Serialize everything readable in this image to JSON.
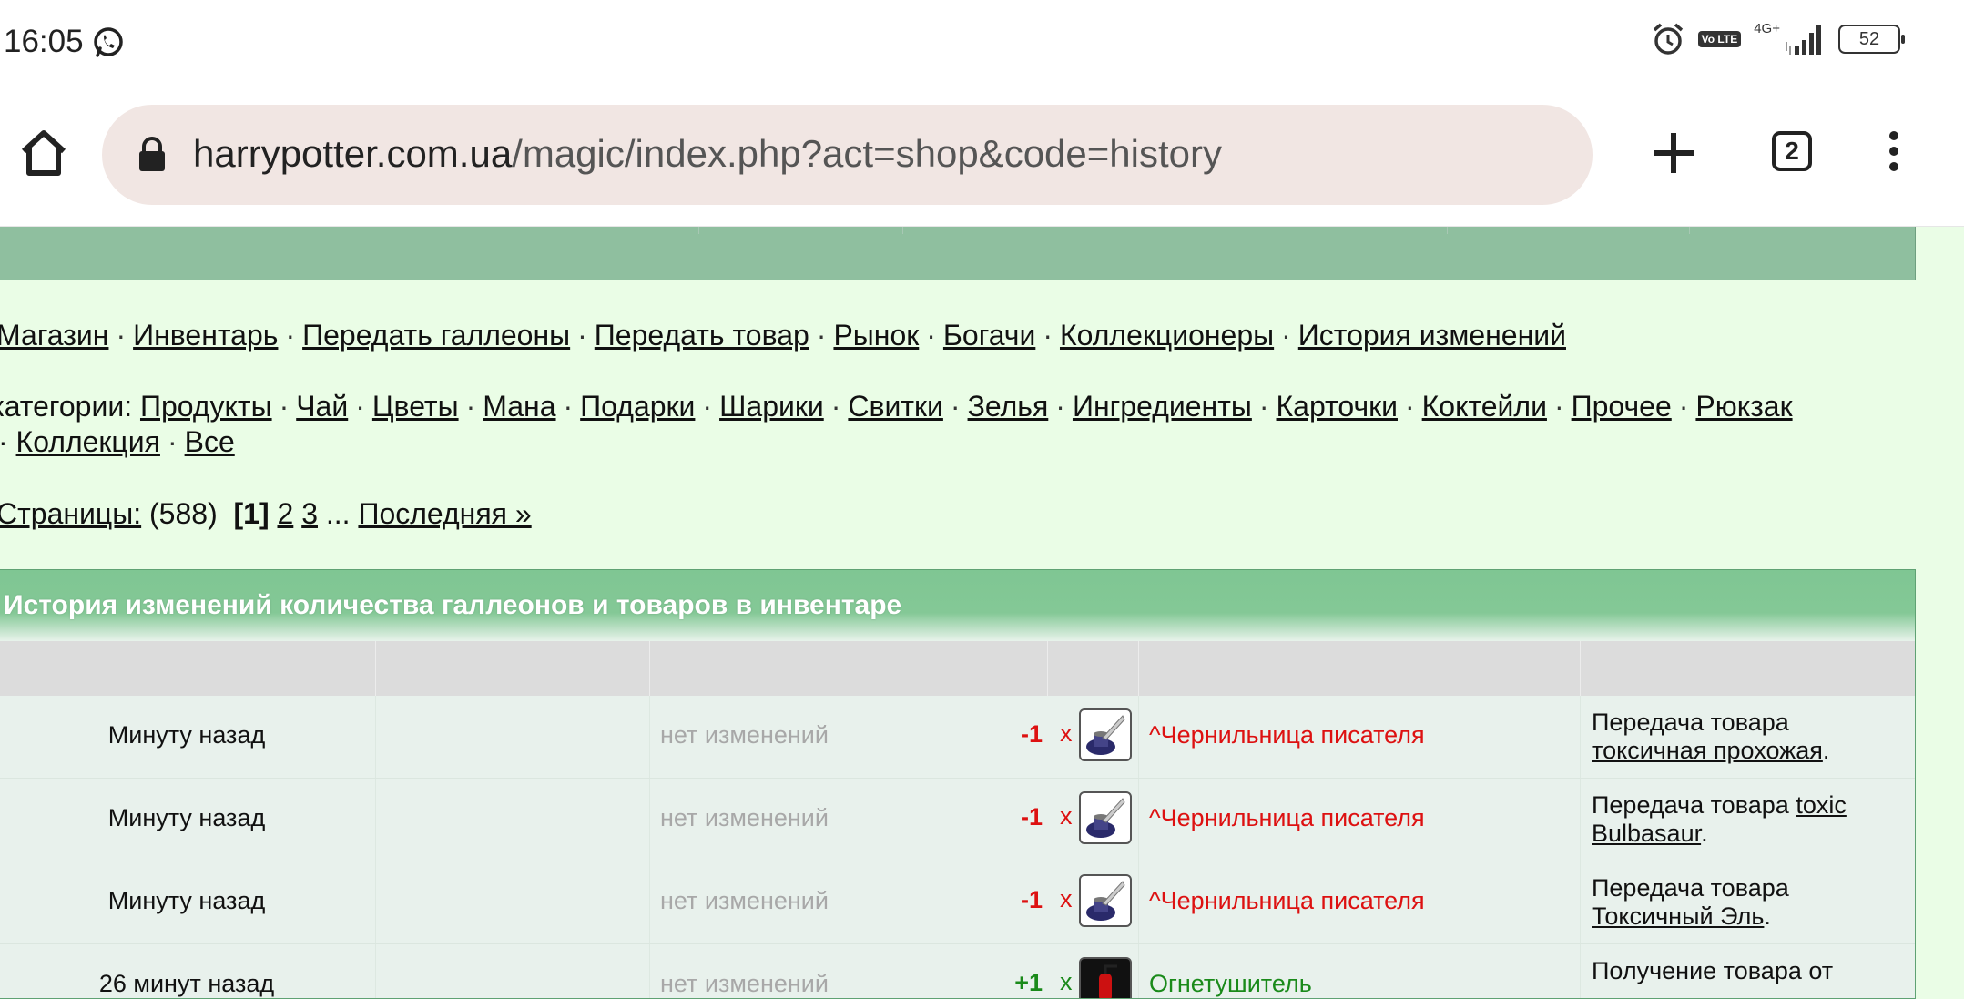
{
  "status_bar": {
    "time": "16:05",
    "battery": "52",
    "network": "4G+",
    "volte": "Vo LTE"
  },
  "browser": {
    "url_host": "harrypotter.com.ua",
    "url_path": "/magic/index.php?act=shop&code=history",
    "tab_count": "2"
  },
  "nav": {
    "items": [
      "Магазин",
      "Инвентарь",
      "Передать галлеоны",
      "Передать товар",
      "Рынок",
      "Богачи",
      "Коллекционеры",
      "История изменений"
    ],
    "separator": "·"
  },
  "categories": {
    "label": "категории:",
    "items": [
      "Продукты",
      "Чай",
      "Цветы",
      "Мана",
      "Подарки",
      "Шарики",
      "Свитки",
      "Зелья",
      "Ингредиенты",
      "Карточки",
      "Коктейли",
      "Прочее",
      "Рюкзак"
    ],
    "items_line2": [
      "Коллекция",
      "Все"
    ]
  },
  "pagination": {
    "label": "Страницы:",
    "total": "(588)",
    "current": "[1]",
    "page2": "2",
    "page3": "3",
    "ellipsis": "...",
    "last": "Последняя »"
  },
  "history": {
    "title": "История изменений количества галлеонов и товаров в инвентаре",
    "rows": [
      {
        "time": "Минуту назад",
        "gold": "нет изменений",
        "qty": "-1",
        "x": "x",
        "item": "^Чернильница писателя",
        "desc_prefix": "Передача товара",
        "desc_link": "токсичная прохожая",
        "desc_suffix": "."
      },
      {
        "time": "Минуту назад",
        "gold": "нет изменений",
        "qty": "-1",
        "x": "x",
        "item": "^Чернильница писателя",
        "desc_prefix": "Передача товара",
        "desc_link": "toxic Bulbasaur",
        "desc_suffix": "."
      },
      {
        "time": "Минуту назад",
        "gold": "нет изменений",
        "qty": "-1",
        "x": "x",
        "item": "^Чернильница писателя",
        "desc_prefix": "Передача товара",
        "desc_link": "Токсичный Эль",
        "desc_suffix": "."
      },
      {
        "time": "26 минут назад",
        "gold": "нет изменений",
        "qty": "+1",
        "x": "x",
        "item": "Огнетушитель",
        "desc_prefix": "Получение товара от",
        "desc_link": "",
        "desc_suffix": ""
      }
    ]
  },
  "colors": {
    "page_bg": "#eafde6",
    "panel_header": "#84c896",
    "negative": "#dd1111",
    "positive": "#1a8a1a"
  }
}
